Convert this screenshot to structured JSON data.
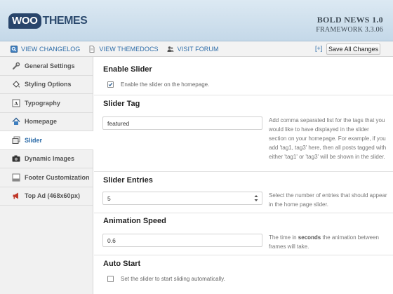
{
  "header": {
    "logo_woo": "WOO",
    "logo_themes": "THEMES",
    "version_title": "BOLD NEWS 1.0",
    "framework": "FRAMEWORK 3.3.06"
  },
  "toolbar": {
    "links": [
      {
        "label": "VIEW CHANGELOG",
        "icon": "changelog-icon"
      },
      {
        "label": "VIEW THEMEDOCS",
        "icon": "document-icon"
      },
      {
        "label": "VISIT FORUM",
        "icon": "forum-icon"
      }
    ],
    "expand_label": "[+]",
    "save_label": "Save All Changes"
  },
  "sidebar": {
    "items": [
      {
        "label": "General Settings",
        "icon": "wrench-icon",
        "active": false
      },
      {
        "label": "Styling Options",
        "icon": "paint-bucket-icon",
        "active": false
      },
      {
        "label": "Typography",
        "icon": "font-icon",
        "active": false
      },
      {
        "label": "Homepage",
        "icon": "home-icon",
        "active": false
      },
      {
        "label": "Slider",
        "icon": "slider-icon",
        "active": true
      },
      {
        "label": "Dynamic Images",
        "icon": "camera-icon",
        "active": false
      },
      {
        "label": "Footer Customization",
        "icon": "footer-icon",
        "active": false
      },
      {
        "label": "Top Ad (468x60px)",
        "icon": "megaphone-icon",
        "active": false
      }
    ]
  },
  "main": {
    "enable_slider": {
      "title": "Enable Slider",
      "checkbox_label": "Enable the slider on the homepage.",
      "checked": true
    },
    "slider_tag": {
      "title": "Slider Tag",
      "value": "featured",
      "description": "Add comma separated list for the tags that you would like to have displayed in the slider section on your homepage. For example, if you add 'tag1, tag3' here, then all posts tagged with either 'tag1' or 'tag3' will be shown in the slider."
    },
    "slider_entries": {
      "title": "Slider Entries",
      "value": "5",
      "description": "Select the number of entries that should appear in the home page slider."
    },
    "animation_speed": {
      "title": "Animation Speed",
      "value": "0.6",
      "description_pre": "The time in ",
      "description_bold": "seconds",
      "description_post": " the animation between frames will take."
    },
    "auto_start": {
      "title": "Auto Start",
      "checkbox_label": "Set the slider to start sliding automatically.",
      "checked": false
    }
  },
  "colors": {
    "accent": "#2d6ca8",
    "header_bg": "#c9dbe9",
    "logo_bg": "#29456b"
  }
}
